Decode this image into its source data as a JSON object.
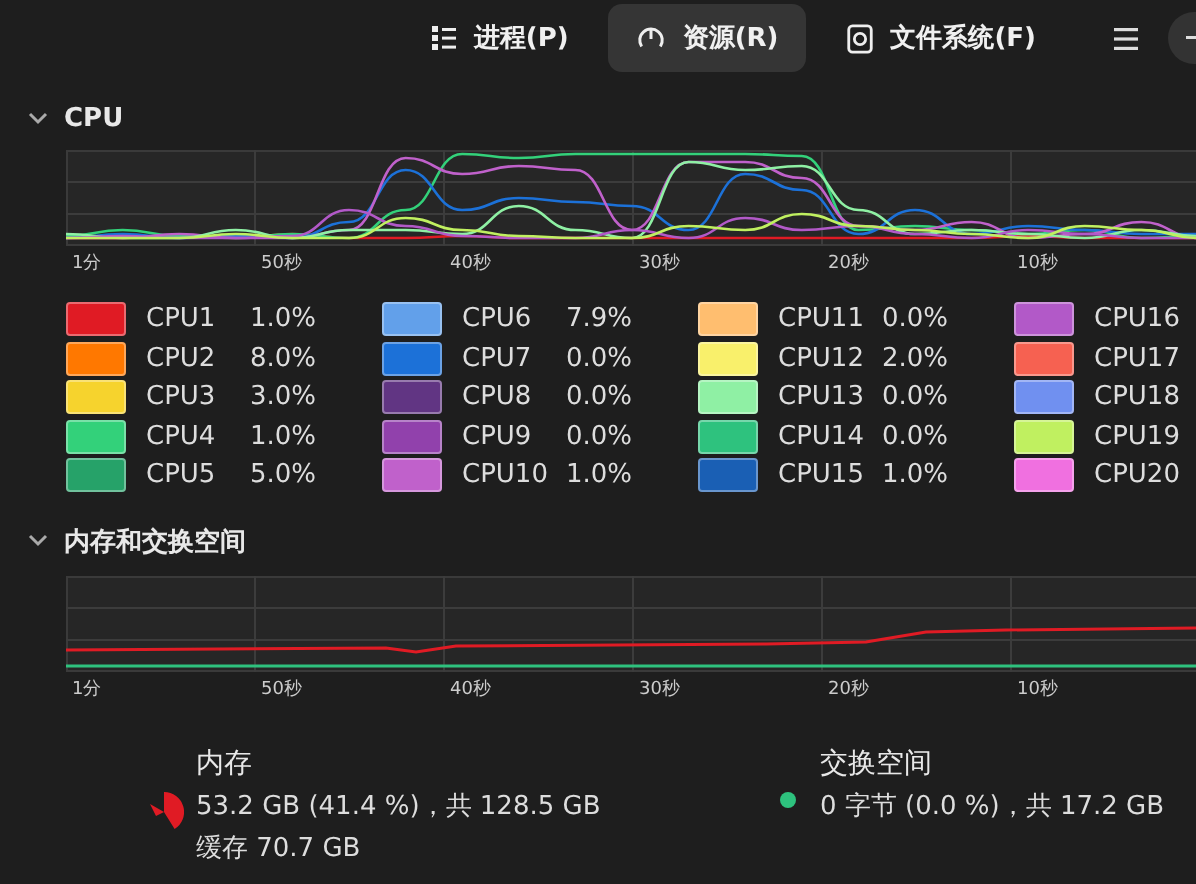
{
  "tabs": [
    {
      "label": "进程(P)",
      "kind": "list",
      "selected": false
    },
    {
      "label": "资源(R)",
      "kind": "gauge",
      "selected": true
    },
    {
      "label": "文件系统(F)",
      "kind": "disk",
      "selected": false
    }
  ],
  "cpu_section": {
    "title": "CPU",
    "expanded": true,
    "time_labels": [
      "1分",
      "50秒",
      "40秒",
      "30秒",
      "20秒",
      "10秒"
    ],
    "cpus": [
      {
        "name": "CPU1",
        "usage": "1.0%",
        "color": "#e01b24"
      },
      {
        "name": "CPU2",
        "usage": "8.0%",
        "color": "#ff7800"
      },
      {
        "name": "CPU3",
        "usage": "3.0%",
        "color": "#f6d32d"
      },
      {
        "name": "CPU4",
        "usage": "1.0%",
        "color": "#33d17a"
      },
      {
        "name": "CPU5",
        "usage": "5.0%",
        "color": "#26a269"
      },
      {
        "name": "CPU6",
        "usage": "7.9%",
        "color": "#62a0ea"
      },
      {
        "name": "CPU7",
        "usage": "0.0%",
        "color": "#1c71d8"
      },
      {
        "name": "CPU8",
        "usage": "0.0%",
        "color": "#613583"
      },
      {
        "name": "CPU9",
        "usage": "0.0%",
        "color": "#9141ac"
      },
      {
        "name": "CPU10",
        "usage": "1.0%",
        "color": "#c061cb"
      },
      {
        "name": "CPU11",
        "usage": "0.0%",
        "color": "#ffbe6f"
      },
      {
        "name": "CPU12",
        "usage": "2.0%",
        "color": "#f9f06b"
      },
      {
        "name": "CPU13",
        "usage": "0.0%",
        "color": "#8ff0a4"
      },
      {
        "name": "CPU14",
        "usage": "0.0%",
        "color": "#2ec27e"
      },
      {
        "name": "CPU15",
        "usage": "1.0%",
        "color": "#1a5fb4"
      },
      {
        "name": "CPU16",
        "color": "#b259c8"
      },
      {
        "name": "CPU17",
        "color": "#f66151"
      },
      {
        "name": "CPU18",
        "color": "#7090f0"
      },
      {
        "name": "CPU19",
        "color": "#c0f060"
      },
      {
        "name": "CPU20",
        "color": "#f070e0"
      }
    ]
  },
  "memory_section": {
    "title": "内存和交换空间",
    "expanded": true,
    "time_labels": [
      "1分",
      "50秒",
      "40秒",
      "30秒",
      "20秒",
      "10秒"
    ],
    "memory": {
      "title": "内存",
      "usage": "53.2 GB (41.4 %)，共 128.5 GB",
      "cache": "缓存 70.7 GB",
      "kind": "pie",
      "color": "#e01b24"
    },
    "swap": {
      "title": "交换空间",
      "usage": "0 字节 (0.0 %)，共 17.2 GB",
      "kind": "dot",
      "color": "#2ec27e"
    }
  }
}
